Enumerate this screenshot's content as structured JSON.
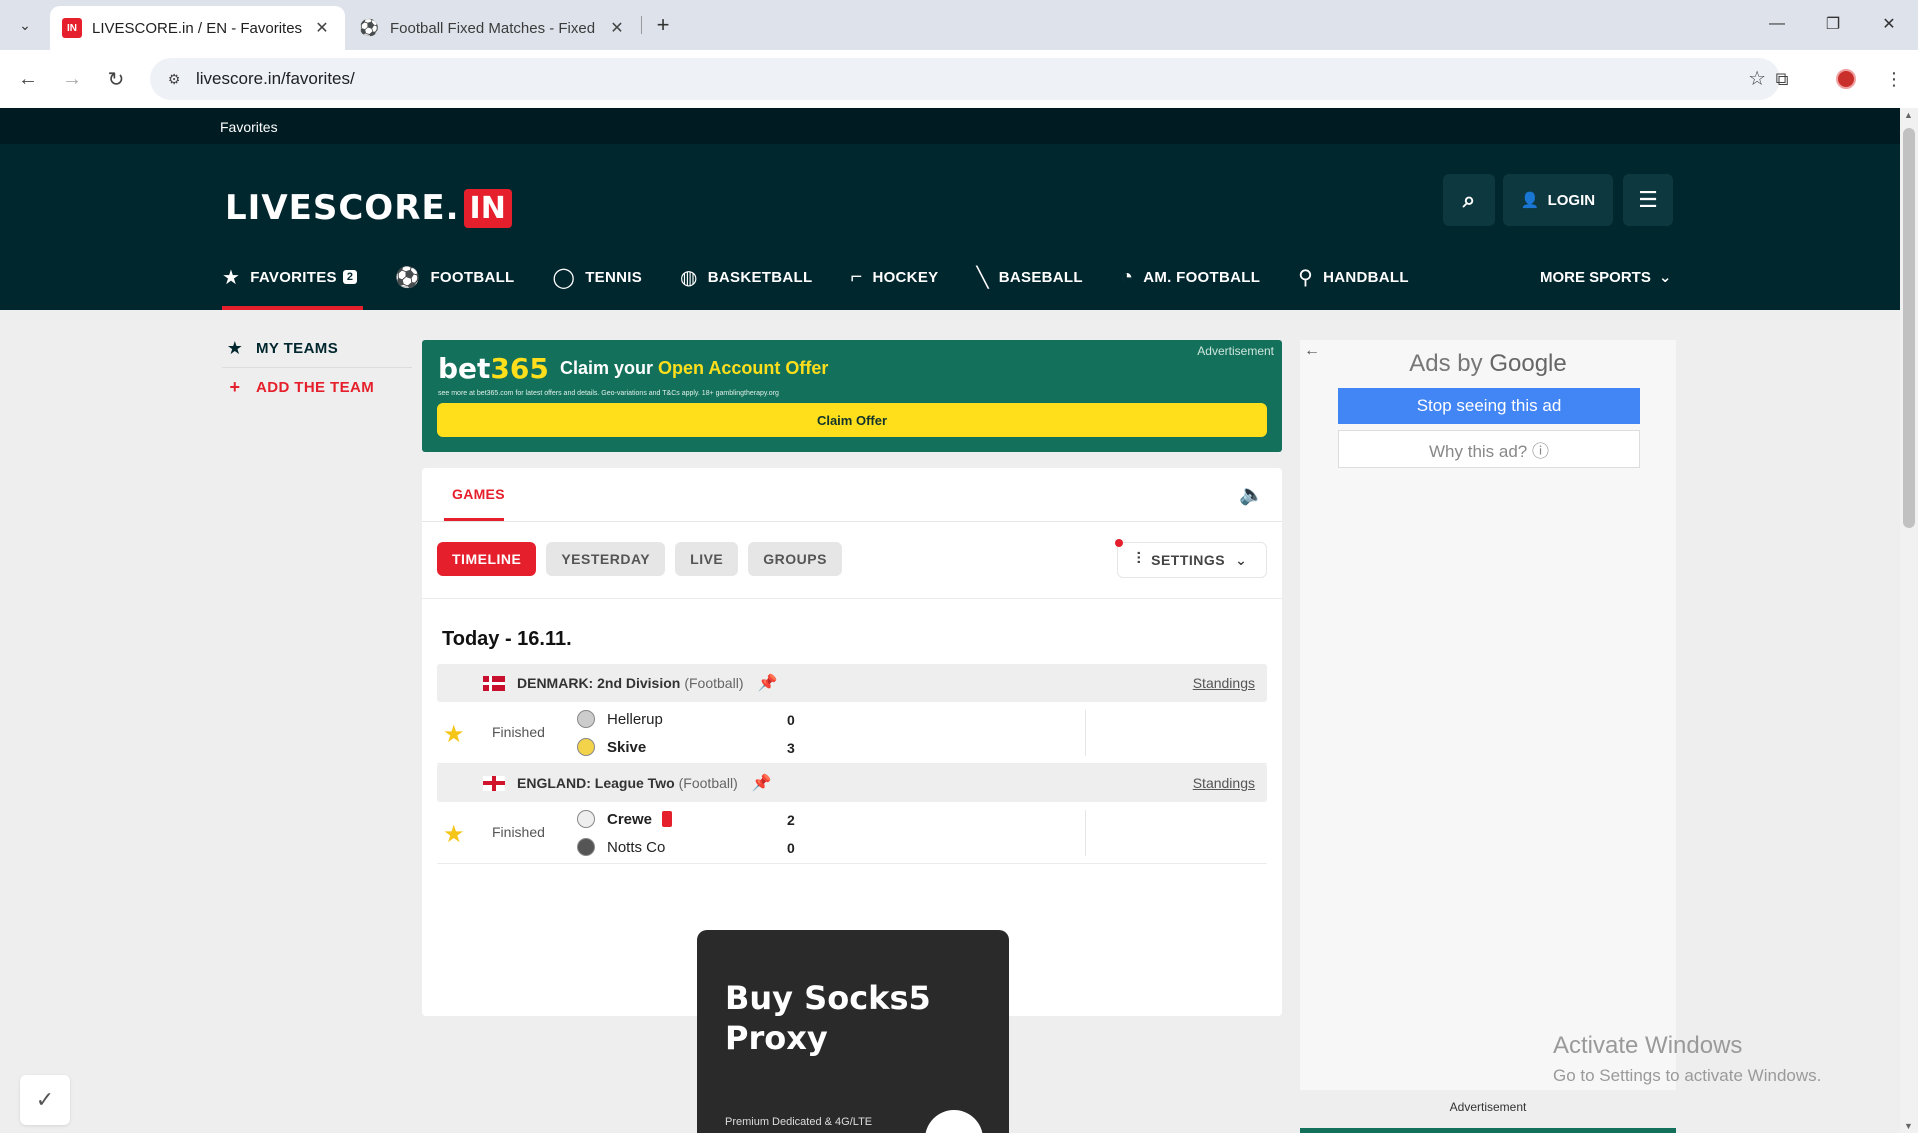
{
  "browser": {
    "tabs": [
      {
        "favicon": "IN",
        "title": "LIVESCORE.in / EN - Favorites",
        "active": true
      },
      {
        "favicon": "soccer-player-icon",
        "title": "Football Fixed Matches - Fixed",
        "active": false
      }
    ],
    "url": "livescore.in/favorites/"
  },
  "site": {
    "breadcrumb": "Favorites",
    "logo_text": "LIVESCORE.",
    "logo_badge": "IN",
    "login_label": "LOGIN",
    "sports": [
      {
        "label": "FAVORITES",
        "icon": "star-icon",
        "badge": "2",
        "active": true
      },
      {
        "label": "FOOTBALL",
        "icon": "football-icon"
      },
      {
        "label": "TENNIS",
        "icon": "tennis-icon"
      },
      {
        "label": "BASKETBALL",
        "icon": "basketball-icon"
      },
      {
        "label": "HOCKEY",
        "icon": "hockey-icon"
      },
      {
        "label": "BASEBALL",
        "icon": "baseball-icon"
      },
      {
        "label": "AM. FOOTBALL",
        "icon": "am-football-icon"
      },
      {
        "label": "HANDBALL",
        "icon": "handball-icon"
      }
    ],
    "more_sports": "MORE SPORTS",
    "accent": "#e5202c",
    "header_bg": "#00262e"
  },
  "sidebar": {
    "my_teams": "MY TEAMS",
    "add_team": "ADD THE TEAM"
  },
  "ad_top": {
    "label": "Advertisement",
    "brand_a": "bet",
    "brand_b": "365",
    "headline_a": "Claim your ",
    "headline_b": "Open Account Offer",
    "fine_print": "see more at bet365.com for latest offers and details. Geo-variations and T&Cs apply. 18+ gamblingtherapy.org",
    "cta": "Claim Offer"
  },
  "games": {
    "tab": "GAMES",
    "filters": [
      "TIMELINE",
      "YESTERDAY",
      "LIVE",
      "GROUPS"
    ],
    "active_filter": "TIMELINE",
    "settings": "SETTINGS",
    "date_heading": "Today - 16.11.",
    "leagues": [
      {
        "country": "DENMARK: 2nd Division",
        "sport": "(Football)",
        "standings": "Standings",
        "match": {
          "status": "Finished",
          "home": "Hellerup",
          "home_score": "0",
          "away": "Skive",
          "away_score": "3",
          "winner": "away",
          "red_card_home": false
        }
      },
      {
        "country": "ENGLAND: League Two",
        "sport": "(Football)",
        "standings": "Standings",
        "match": {
          "status": "Finished",
          "home": "Crewe",
          "home_score": "2",
          "away": "Notts Co",
          "away_score": "0",
          "winner": "home",
          "red_card_home": true
        }
      }
    ]
  },
  "ad_proxy": {
    "title": "Buy Socks5 Proxy",
    "subtitle": "Premium Dedicated & 4G/LTE"
  },
  "ad_right": {
    "ads_by": "Ads by ",
    "google": "Google",
    "stop": "Stop seeing this ad",
    "why": "Why this ad? ⓘ",
    "label": "Advertisement"
  },
  "watermark": {
    "line1": "Activate Windows",
    "line2": "Go to Settings to activate Windows."
  }
}
